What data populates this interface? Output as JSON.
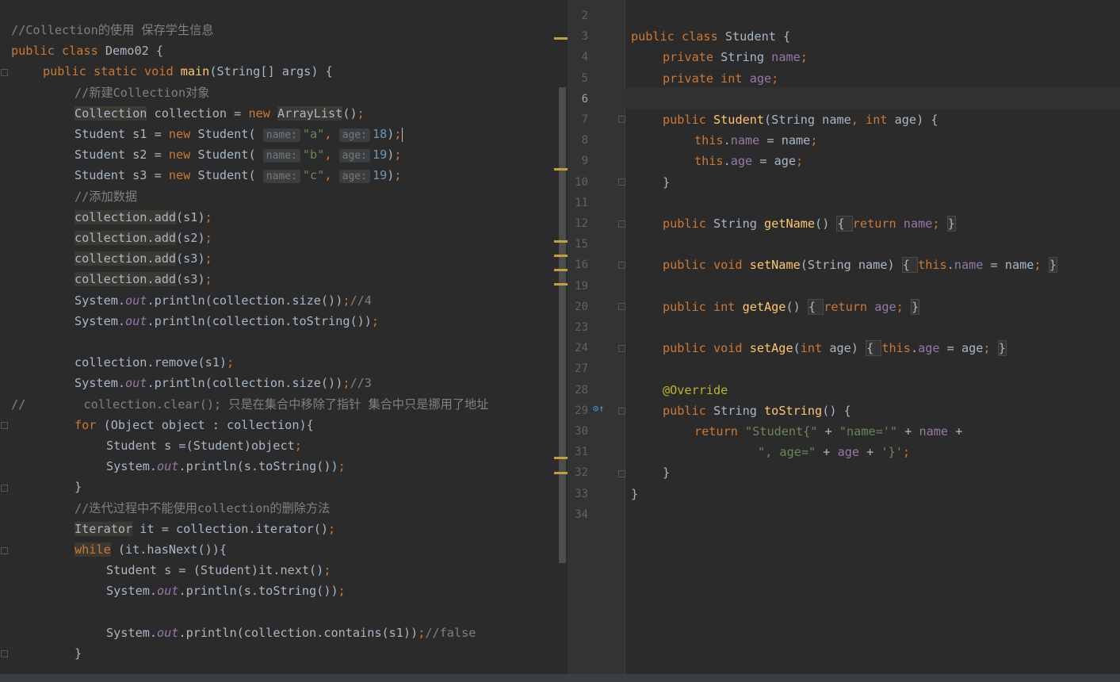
{
  "left_editor": {
    "lines": [
      {
        "indent": 0,
        "parts": [
          [
            "cmt",
            "//Collection的使用 保存学生信息"
          ]
        ]
      },
      {
        "indent": 0,
        "parts": [
          [
            "kw",
            "public class "
          ],
          [
            "",
            "Demo02 {"
          ]
        ]
      },
      {
        "indent": 1,
        "parts": [
          [
            "kw",
            "public static void "
          ],
          [
            "fn",
            "main"
          ],
          [
            "",
            "(String[] args) {"
          ]
        ]
      },
      {
        "indent": 2,
        "parts": [
          [
            "cmt",
            "//新建Collection对象"
          ]
        ]
      },
      {
        "indent": 2,
        "parts": [
          [
            "hl",
            "Collection"
          ],
          [
            "",
            " collection = "
          ],
          [
            "kw",
            "new "
          ],
          [
            "hl",
            "ArrayList"
          ],
          [
            "",
            "()"
          ],
          [
            "kw",
            ";"
          ]
        ]
      },
      {
        "indent": 2,
        "parts": [
          [
            "",
            "Student s1 = "
          ],
          [
            "kw",
            "new "
          ],
          [
            "",
            "Student( "
          ],
          [
            "hint",
            "name:"
          ],
          [
            "str",
            "\"a\""
          ],
          [
            "kw",
            ", "
          ],
          [
            "hint",
            "age:"
          ],
          [
            "num",
            "18"
          ],
          [
            "",
            ")"
          ],
          [
            "kw",
            ";"
          ],
          [
            "caret",
            ""
          ]
        ]
      },
      {
        "indent": 2,
        "parts": [
          [
            "",
            "Student s2 = "
          ],
          [
            "kw",
            "new "
          ],
          [
            "",
            "Student( "
          ],
          [
            "hint",
            "name:"
          ],
          [
            "str",
            "\"b\""
          ],
          [
            "kw",
            ", "
          ],
          [
            "hint",
            "age:"
          ],
          [
            "num",
            "19"
          ],
          [
            "",
            ")"
          ],
          [
            "kw",
            ";"
          ]
        ]
      },
      {
        "indent": 2,
        "parts": [
          [
            "",
            "Student s3 = "
          ],
          [
            "kw",
            "new "
          ],
          [
            "",
            "Student( "
          ],
          [
            "hint",
            "name:"
          ],
          [
            "str",
            "\"c\""
          ],
          [
            "kw",
            ", "
          ],
          [
            "hint",
            "age:"
          ],
          [
            "num",
            "19"
          ],
          [
            "",
            ")"
          ],
          [
            "kw",
            ";"
          ]
        ]
      },
      {
        "indent": 2,
        "parts": [
          [
            "cmt",
            "//添加数据"
          ]
        ]
      },
      {
        "indent": 2,
        "parts": [
          [
            "hl",
            "collection.add"
          ],
          [
            "",
            "(s1)"
          ],
          [
            "kw",
            ";"
          ]
        ]
      },
      {
        "indent": 2,
        "parts": [
          [
            "hl",
            "collection.add"
          ],
          [
            "",
            "(s2)"
          ],
          [
            "kw",
            ";"
          ]
        ]
      },
      {
        "indent": 2,
        "parts": [
          [
            "hl",
            "collection.add"
          ],
          [
            "",
            "(s3)"
          ],
          [
            "kw",
            ";"
          ]
        ]
      },
      {
        "indent": 2,
        "parts": [
          [
            "hl",
            "collection.add"
          ],
          [
            "",
            "(s3)"
          ],
          [
            "kw",
            ";"
          ]
        ]
      },
      {
        "indent": 2,
        "parts": [
          [
            "",
            "System."
          ],
          [
            "static",
            "out"
          ],
          [
            "",
            ".println(collection.size())"
          ],
          [
            "kw",
            ";"
          ],
          [
            "cmt",
            "//4"
          ]
        ]
      },
      {
        "indent": 2,
        "parts": [
          [
            "",
            "System."
          ],
          [
            "static",
            "out"
          ],
          [
            "",
            ".println(collection.toString())"
          ],
          [
            "kw",
            ";"
          ]
        ]
      },
      {
        "indent": 0,
        "parts": []
      },
      {
        "indent": 2,
        "parts": [
          [
            "",
            "collection.remove(s1)"
          ],
          [
            "kw",
            ";"
          ]
        ]
      },
      {
        "indent": 2,
        "parts": [
          [
            "",
            "System."
          ],
          [
            "static",
            "out"
          ],
          [
            "",
            ".println(collection.size())"
          ],
          [
            "kw",
            ";"
          ],
          [
            "cmt",
            "//3"
          ]
        ]
      },
      {
        "indent": 0,
        "parts": [
          [
            "cmt",
            "//        collection.clear(); 只是在集合中移除了指针 集合中只是挪用了地址"
          ]
        ]
      },
      {
        "indent": 2,
        "parts": [
          [
            "kw",
            "for "
          ],
          [
            "",
            "(Object object : collection){"
          ]
        ]
      },
      {
        "indent": 3,
        "parts": [
          [
            "",
            "Student s =(Student)object"
          ],
          [
            "kw",
            ";"
          ]
        ]
      },
      {
        "indent": 3,
        "parts": [
          [
            "",
            "System."
          ],
          [
            "static",
            "out"
          ],
          [
            "",
            ".println(s.toString())"
          ],
          [
            "kw",
            ";"
          ]
        ]
      },
      {
        "indent": 2,
        "parts": [
          [
            "",
            "}"
          ]
        ]
      },
      {
        "indent": 2,
        "parts": [
          [
            "cmt",
            "//迭代过程中不能使用collection的删除方法"
          ]
        ]
      },
      {
        "indent": 2,
        "parts": [
          [
            "hl",
            "Iterator"
          ],
          [
            "",
            " it = collection.iterator()"
          ],
          [
            "kw",
            ";"
          ]
        ]
      },
      {
        "indent": 2,
        "parts": [
          [
            "hlkw",
            "while"
          ],
          [
            "",
            " (it.hasNext()){"
          ]
        ]
      },
      {
        "indent": 3,
        "parts": [
          [
            "",
            "Student s = (Student)it.next()"
          ],
          [
            "kw",
            ";"
          ]
        ]
      },
      {
        "indent": 3,
        "parts": [
          [
            "",
            "System."
          ],
          [
            "static",
            "out"
          ],
          [
            "",
            ".println(s.toString())"
          ],
          [
            "kw",
            ";"
          ]
        ]
      },
      {
        "indent": 0,
        "parts": []
      },
      {
        "indent": 3,
        "parts": [
          [
            "",
            "System."
          ],
          [
            "static",
            "out"
          ],
          [
            "",
            ".println(collection.contains(s1))"
          ],
          [
            "kw",
            ";"
          ],
          [
            "cmt",
            "//false"
          ]
        ]
      },
      {
        "indent": 2,
        "parts": [
          [
            "",
            "}"
          ]
        ]
      }
    ]
  },
  "right_editor": {
    "line_numbers": [
      "2",
      "3",
      "4",
      "5",
      "6",
      "7",
      "8",
      "9",
      "10",
      "11",
      "12",
      "15",
      "16",
      "19",
      "20",
      "23",
      "24",
      "27",
      "28",
      "29",
      "30",
      "31",
      "32",
      "33",
      "34"
    ],
    "current_line": "6",
    "lines": [
      {
        "indent": 0,
        "parts": []
      },
      {
        "indent": 0,
        "parts": [
          [
            "kw",
            "public class "
          ],
          [
            "",
            "Student {"
          ]
        ]
      },
      {
        "indent": 1,
        "parts": [
          [
            "kw",
            "private "
          ],
          [
            "",
            "String "
          ],
          [
            "fld",
            "name"
          ],
          [
            "kw",
            ";"
          ]
        ]
      },
      {
        "indent": 1,
        "parts": [
          [
            "kw",
            "private int "
          ],
          [
            "fld",
            "age"
          ],
          [
            "kw",
            ";"
          ]
        ]
      },
      {
        "indent": 0,
        "parts": []
      },
      {
        "indent": 1,
        "parts": [
          [
            "kw",
            "public "
          ],
          [
            "fn",
            "Student"
          ],
          [
            "",
            "(String name"
          ],
          [
            "kw",
            ", int "
          ],
          [
            "",
            "age) {"
          ]
        ]
      },
      {
        "indent": 2,
        "parts": [
          [
            "kw",
            "this"
          ],
          [
            "",
            "."
          ],
          [
            "fld",
            "name"
          ],
          [
            "",
            " = name"
          ],
          [
            "kw",
            ";"
          ]
        ]
      },
      {
        "indent": 2,
        "parts": [
          [
            "kw",
            "this"
          ],
          [
            "",
            "."
          ],
          [
            "fld",
            "age"
          ],
          [
            "",
            " = age"
          ],
          [
            "kw",
            ";"
          ]
        ]
      },
      {
        "indent": 1,
        "parts": [
          [
            "",
            "}"
          ]
        ]
      },
      {
        "indent": 0,
        "parts": []
      },
      {
        "indent": 1,
        "parts": [
          [
            "kw",
            "public "
          ],
          [
            "",
            "String "
          ],
          [
            "fn",
            "getName"
          ],
          [
            "",
            "() "
          ],
          [
            "fold",
            "{ "
          ],
          [
            "kw",
            "return "
          ],
          [
            "fld",
            "name"
          ],
          [
            "kw",
            "; "
          ],
          [
            "fold",
            "}"
          ]
        ]
      },
      {
        "indent": 0,
        "parts": []
      },
      {
        "indent": 1,
        "parts": [
          [
            "kw",
            "public void "
          ],
          [
            "fn",
            "setName"
          ],
          [
            "",
            "(String name) "
          ],
          [
            "fold",
            "{ "
          ],
          [
            "kw",
            "this"
          ],
          [
            "",
            "."
          ],
          [
            "fld",
            "name"
          ],
          [
            "",
            " = name"
          ],
          [
            "kw",
            "; "
          ],
          [
            "fold",
            "}"
          ]
        ]
      },
      {
        "indent": 0,
        "parts": []
      },
      {
        "indent": 1,
        "parts": [
          [
            "kw",
            "public int "
          ],
          [
            "fn",
            "getAge"
          ],
          [
            "",
            "() "
          ],
          [
            "fold",
            "{ "
          ],
          [
            "kw",
            "return "
          ],
          [
            "fld",
            "age"
          ],
          [
            "kw",
            "; "
          ],
          [
            "fold",
            "}"
          ]
        ]
      },
      {
        "indent": 0,
        "parts": []
      },
      {
        "indent": 1,
        "parts": [
          [
            "kw",
            "public void "
          ],
          [
            "fn",
            "setAge"
          ],
          [
            "",
            "("
          ],
          [
            "kw",
            "int "
          ],
          [
            "",
            "age) "
          ],
          [
            "fold",
            "{ "
          ],
          [
            "kw",
            "this"
          ],
          [
            "",
            "."
          ],
          [
            "fld",
            "age"
          ],
          [
            "",
            " = age"
          ],
          [
            "kw",
            "; "
          ],
          [
            "fold",
            "}"
          ]
        ]
      },
      {
        "indent": 0,
        "parts": []
      },
      {
        "indent": 1,
        "parts": [
          [
            "ann",
            "@Override"
          ]
        ]
      },
      {
        "indent": 1,
        "parts": [
          [
            "kw",
            "public "
          ],
          [
            "",
            "String "
          ],
          [
            "fn",
            "toString"
          ],
          [
            "",
            "() {"
          ]
        ]
      },
      {
        "indent": 2,
        "parts": [
          [
            "kw",
            "return "
          ],
          [
            "str",
            "\"Student{\""
          ],
          [
            "",
            " + "
          ],
          [
            "str",
            "\"name='\""
          ],
          [
            "",
            " + "
          ],
          [
            "fld",
            "name"
          ],
          [
            "",
            " +"
          ]
        ]
      },
      {
        "indent": 4,
        "parts": [
          [
            "str",
            "\", age=\""
          ],
          [
            "",
            " + "
          ],
          [
            "fld",
            "age"
          ],
          [
            "",
            " + "
          ],
          [
            "str",
            "'}'"
          ],
          [
            "kw",
            ";"
          ]
        ]
      },
      {
        "indent": 1,
        "parts": [
          [
            "",
            "}"
          ]
        ]
      },
      {
        "indent": 0,
        "parts": [
          [
            "",
            "}"
          ]
        ]
      },
      {
        "indent": 0,
        "parts": []
      }
    ]
  }
}
